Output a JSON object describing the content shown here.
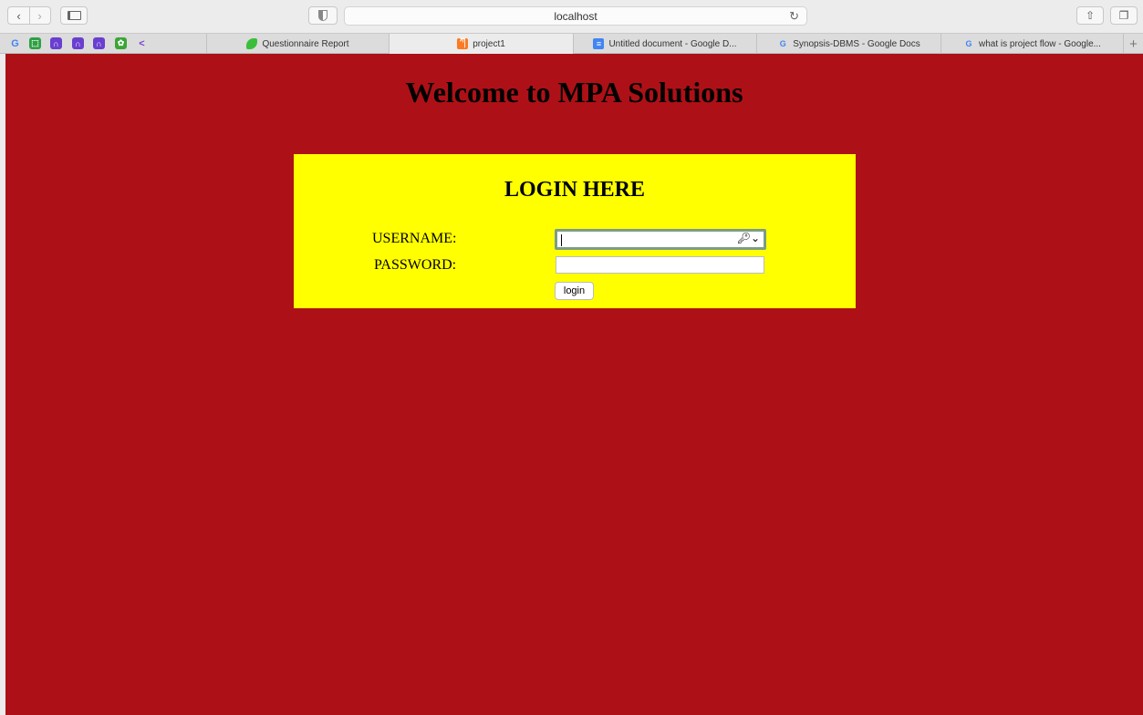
{
  "browser": {
    "address": "localhost",
    "bookmarks": [
      {
        "icon": "google-icon",
        "glyph": "G",
        "color": "#4285f4"
      },
      {
        "icon": "green-app-icon",
        "glyph": "⬚",
        "color": "#2ea043"
      },
      {
        "icon": "rainbow-arch-icon",
        "glyph": "∩",
        "color": "#6a3fd0"
      },
      {
        "icon": "rainbow-arch-icon",
        "glyph": "∩",
        "color": "#6a3fd0"
      },
      {
        "icon": "rainbow-arch-icon",
        "glyph": "∩",
        "color": "#6a3fd0"
      },
      {
        "icon": "green-gear-icon",
        "glyph": "✿",
        "color": "#3aa635"
      },
      {
        "icon": "chevron-left-icon",
        "glyph": "<",
        "color": "#7a3fd8"
      }
    ],
    "tabs": [
      {
        "title": "Questionnaire Report",
        "icon": "leaf-icon",
        "icon_glyph": "",
        "icon_color": "#3bbf3b",
        "active": false
      },
      {
        "title": "project1",
        "icon": "xampp-icon",
        "icon_glyph": "ཀ",
        "icon_color": "#fb7a24",
        "active": true
      },
      {
        "title": "Untitled document - Google D...",
        "icon": "google-docs-icon",
        "icon_glyph": "≡",
        "icon_color": "#4285f4",
        "active": false
      },
      {
        "title": "Synopsis-DBMS - Google Docs",
        "icon": "google-icon",
        "icon_glyph": "G",
        "icon_color": "#4285f4",
        "active": false
      },
      {
        "title": "what is project flow - Google...",
        "icon": "google-icon",
        "icon_glyph": "G",
        "icon_color": "#4285f4",
        "active": false
      }
    ]
  },
  "page": {
    "background": "#ad1117",
    "heading": "Welcome to MPA Solutions",
    "login": {
      "background": "#ffff00",
      "title": "LOGIN HERE",
      "username_label": "USERNAME:",
      "username_value": "",
      "password_label": "PASSWORD:",
      "password_value": "",
      "button_label": "login"
    }
  }
}
